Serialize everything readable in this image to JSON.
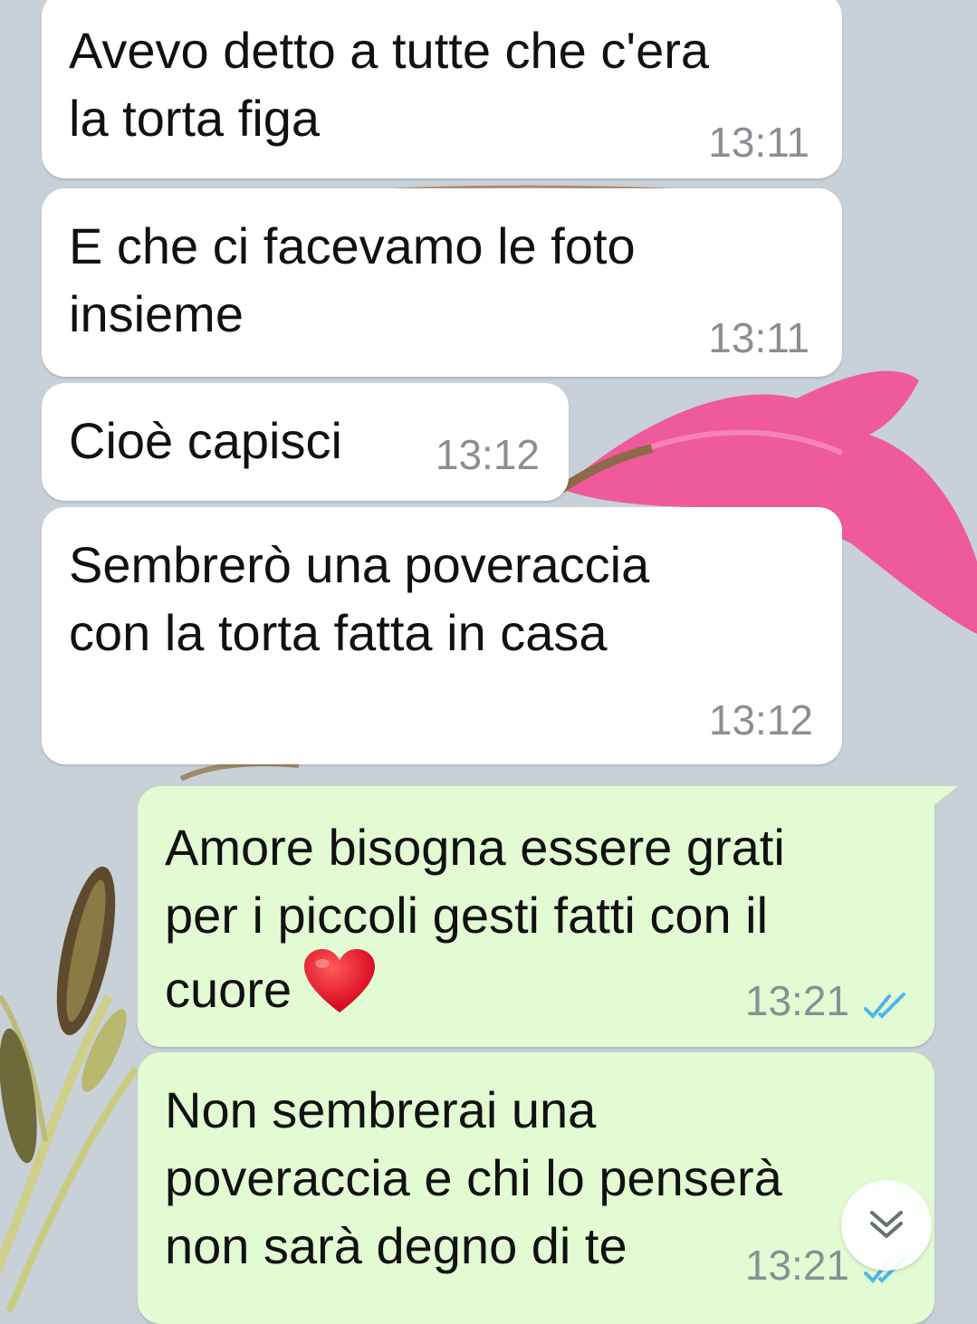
{
  "colors": {
    "incoming_bubble": "#ffffff",
    "outgoing_bubble": "#e2fbd3",
    "timestamp": "#8a8f93",
    "read_ticks": "#4fb6ec",
    "wallpaper": "#c7cfd7",
    "flower": "#f0579c"
  },
  "messages": [
    {
      "direction": "incoming",
      "text": "Avevo detto a tutte che c'era\nla torta figa",
      "time": "13:11"
    },
    {
      "direction": "incoming",
      "text": "E che ci facevamo le foto\ninsieme",
      "time": "13:11"
    },
    {
      "direction": "incoming",
      "text": "Cioè capisci",
      "time": "13:12"
    },
    {
      "direction": "incoming",
      "text": "Sembrerò una poveraccia\ncon la torta fatta in casa",
      "time": "13:12"
    },
    {
      "direction": "outgoing",
      "text": "Amore bisogna essere grati\nper i piccoli gesti fatti con il\ncuore",
      "emoji": "heart",
      "time": "13:21",
      "status": "read"
    },
    {
      "direction": "outgoing",
      "text": "Non sembrerai una\npoveraccia e chi lo penserà\nnon sarà degno di te",
      "time": "13:21",
      "status": "read"
    }
  ],
  "scroll_button_icon": "chevron-double-down-icon"
}
